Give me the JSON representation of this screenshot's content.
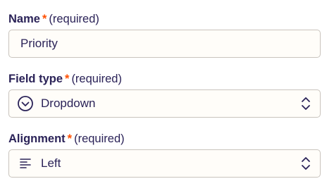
{
  "fields": {
    "name": {
      "label": "Name",
      "required_mark": "*",
      "required_text": "(required)",
      "value": "Priority"
    },
    "field_type": {
      "label": "Field type",
      "required_mark": "*",
      "required_text": "(required)",
      "value": "Dropdown",
      "icon": "circle-chevron-down-icon"
    },
    "alignment": {
      "label": "Alignment",
      "required_mark": "*",
      "required_text": "(required)",
      "value": "Left",
      "icon": "align-left-icon"
    }
  },
  "colors": {
    "text": "#2b2358",
    "required_accent": "#ff4f00",
    "border": "#c9c4bd",
    "input_background": "#fffdf9"
  }
}
